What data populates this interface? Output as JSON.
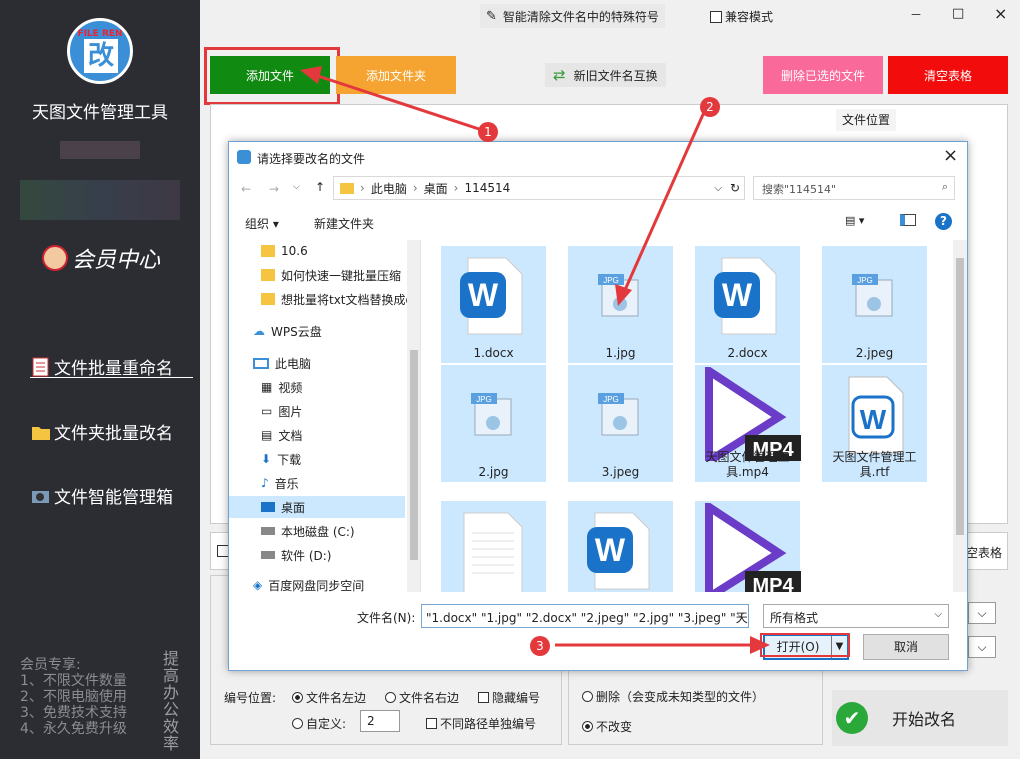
{
  "app": {
    "title": "天图文件管理工具",
    "logo_text": "FILE REN",
    "logo_glyph": "改"
  },
  "sidebar": {
    "member_center": "会员中心",
    "nav": [
      {
        "label": "文件批量重命名",
        "icon": "document-icon"
      },
      {
        "label": "文件夹批量改名",
        "icon": "folder-icon"
      },
      {
        "label": "文件智能管理箱",
        "icon": "toolbox-icon"
      }
    ],
    "perks_title": "会员专享:",
    "perks": [
      "1、不限文件数量",
      "2、不限电脑使用",
      "3、免费技术支持",
      "4、永久免费升级"
    ],
    "slogan": "提高办公效率"
  },
  "topbar": {
    "feature": "智能清除文件名中的特殊符号",
    "compat": "兼容模式",
    "win_min": "－",
    "win_max": "□",
    "win_close": "×"
  },
  "toolbar": {
    "add_file": "添加文件",
    "add_folder": "添加文件夹",
    "swap": "新旧文件名互换",
    "delete_selected": "删除已选的文件",
    "clear_table": "清空表格"
  },
  "table": {
    "col_location": "文件位置",
    "clear_table_right": "空表格"
  },
  "bottom": {
    "numbering_label": "编号位置:",
    "opt_left": "文件名左边",
    "opt_right": "文件名右边",
    "opt_hide": "隐藏编号",
    "opt_custom": "自定义:",
    "custom_value": "2",
    "opt_sep": "不同路径单独编号",
    "ext_delete": "删除（会变成未知类型的文件）",
    "ext_keep": "不改变",
    "start": "开始改名"
  },
  "annotations": [
    "1",
    "2",
    "3"
  ],
  "dialog": {
    "title": "请选择要改名的文件",
    "close": "×",
    "path": [
      "此电脑",
      "桌面",
      "114514"
    ],
    "search_placeholder": "搜索\"114514\"",
    "organize": "组织",
    "new_folder": "新建文件夹",
    "tree": [
      "10.6",
      "如何快速一键批量压缩",
      "想批量将txt文档替换成d",
      "WPS云盘",
      "此电脑",
      "视频",
      "图片",
      "文档",
      "下载",
      "音乐",
      "桌面",
      "本地磁盘 (C:)",
      "软件 (D:)",
      "百度网盘同步空间"
    ],
    "files": [
      {
        "name": "1.docx",
        "type": "wps"
      },
      {
        "name": "1.jpg",
        "type": "jpg"
      },
      {
        "name": "2.docx",
        "type": "wps"
      },
      {
        "name": "2.jpeg",
        "type": "jpg"
      },
      {
        "name": "2.jpg",
        "type": "jpg"
      },
      {
        "name": "3.jpeg",
        "type": "jpg"
      },
      {
        "name": "天图文件管理工具.mp4",
        "type": "mp4"
      },
      {
        "name": "天图文件管理工具.rtf",
        "type": "rtf"
      },
      {
        "name": "",
        "type": "txt"
      },
      {
        "name": "",
        "type": "wps"
      },
      {
        "name": "",
        "type": "mp4"
      }
    ],
    "filename_label": "文件名(N):",
    "filename_value": "\"1.docx\" \"1.jpg\" \"2.docx\" \"2.jpeg\" \"2.jpg\" \"3.jpeg\" \"天",
    "filter": "所有格式",
    "open": "打开(O)",
    "cancel": "取消"
  },
  "colors": {
    "sidebar": "#2b2d33",
    "green": "#118a11",
    "orange": "#f5a431",
    "pink": "#f9699a",
    "red": "#f20c0c",
    "annotation": "#e4393c"
  }
}
